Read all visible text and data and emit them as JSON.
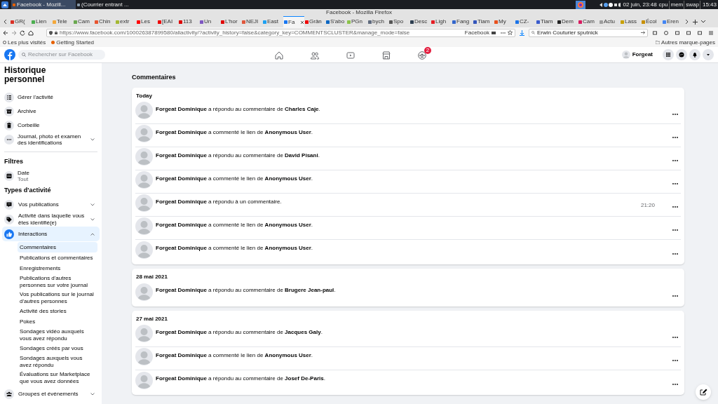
{
  "taskbar": {
    "windows": [
      {
        "title": "Facebook - Mozill...",
        "selected": true
      },
      {
        "title": "(Courrier entrant ...",
        "selected": false
      }
    ],
    "date": "02 juin, 23:48",
    "meters": [
      "cpu",
      "mem",
      "swap"
    ],
    "clock": "15:43"
  },
  "window": {
    "title": "Facebook - Mozilla Firefox"
  },
  "tabs": [
    {
      "label": "GR(",
      "color": "#d93025",
      "selected": false
    },
    {
      "label": "Lien",
      "color": "#4caf50",
      "selected": false
    },
    {
      "label": "Tele",
      "color": "#f4a83a",
      "selected": false
    },
    {
      "label": "Cam",
      "color": "#6aa84f",
      "selected": false
    },
    {
      "label": "Chin",
      "color": "#e8542f",
      "selected": false
    },
    {
      "label": "extr",
      "color": "#a4b832",
      "selected": false
    },
    {
      "label": "Les",
      "color": "#ff0000",
      "selected": false
    },
    {
      "label": "[EAI",
      "color": "#ee0000",
      "selected": false
    },
    {
      "label": "113",
      "color": "#dd0000",
      "selected": false
    },
    {
      "label": "Un",
      "color": "#7e57c2",
      "selected": false
    },
    {
      "label": "L'hor",
      "color": "#e00000",
      "selected": false
    },
    {
      "label": "NEJI",
      "color": "#e0573c",
      "selected": false
    },
    {
      "label": "East",
      "color": "#1da1f2",
      "selected": false
    },
    {
      "label": "Fa",
      "color": "#1877f2",
      "selected": true
    },
    {
      "label": "Grân",
      "color": "#f00000",
      "selected": false
    },
    {
      "label": "S'abo",
      "color": "#0a66c2",
      "selected": false
    },
    {
      "label": "PGn",
      "color": "#8bc34a",
      "selected": false
    },
    {
      "label": "bych",
      "color": "#5f6a7d",
      "selected": false
    },
    {
      "label": "Spo",
      "color": "#555555",
      "selected": false
    },
    {
      "label": "Desc",
      "color": "#2d3e50",
      "selected": false
    },
    {
      "label": "Ligh",
      "color": "#e51c23",
      "selected": false
    },
    {
      "label": "Fang",
      "color": "#3366cc",
      "selected": false
    },
    {
      "label": "Tiam",
      "color": "#3355bb",
      "selected": false
    },
    {
      "label": "My",
      "color": "#e8501d",
      "selected": false
    },
    {
      "label": "CZ-",
      "color": "#1a73e8",
      "selected": false
    },
    {
      "label": "Tiam",
      "color": "#3a5bcc",
      "selected": false
    },
    {
      "label": "Dem",
      "color": "#222222",
      "selected": false
    },
    {
      "label": "Cam",
      "color": "#d81b60",
      "selected": false
    },
    {
      "label": "Actu",
      "color": "#9e9e9e",
      "selected": false
    },
    {
      "label": "Lass",
      "color": "#c8a000",
      "selected": false
    },
    {
      "label": "Écol",
      "color": "#c89000",
      "selected": false
    },
    {
      "label": "Eren",
      "color": "#4285f4",
      "selected": false
    }
  ],
  "address_bar": {
    "url": "https://www.facebook.com/100026387899580/allactivity/?activity_history=false&category_key=COMMENTSCLUSTER&manage_mode=false",
    "site_label": "Facebook"
  },
  "web_search": {
    "value": "Erwin Couturier sputnick"
  },
  "bookmarks": [
    {
      "label": "Les plus visités"
    },
    {
      "label": "Getting Started"
    }
  ],
  "other_bookmarks": "Autres marque-pages",
  "facebook_header": {
    "search_placeholder": "Rechercher sur Facebook",
    "nav": [
      {
        "kind": "home"
      },
      {
        "kind": "friends"
      },
      {
        "kind": "watch"
      },
      {
        "kind": "marketplace"
      },
      {
        "kind": "groups",
        "badge": "2"
      }
    ],
    "profile_name": "Forgeat"
  },
  "sidebar": {
    "title": "Historique personnel",
    "menu": [
      {
        "label": "Gérer l'activité",
        "kind": "list"
      },
      {
        "label": "Archive",
        "kind": "archive"
      },
      {
        "label": "Corbeille",
        "kind": "trash"
      },
      {
        "label": "Journal, photo et examen des identifications",
        "kind": "more",
        "expanded": false
      }
    ],
    "filters_title": "Filtres",
    "filters": [
      {
        "label": "Date",
        "value": "Tout",
        "kind": "calendar"
      }
    ],
    "types_title": "Types d'activité",
    "types": [
      {
        "label": "Vos publications",
        "kind": "post",
        "expanded": false,
        "selected": false
      },
      {
        "label": "Activité dans laquelle vous êtes identifié(e)",
        "kind": "tag",
        "expanded": false,
        "selected": false
      },
      {
        "label": "Interactions",
        "kind": "like",
        "expanded": true,
        "selected": true,
        "children": [
          {
            "label": "Commentaires",
            "selected": true
          },
          {
            "label": "Publications et commentaires",
            "selected": false
          },
          {
            "label": "Enregistrements",
            "selected": false
          },
          {
            "label": "Publications d'autres personnes sur votre journal",
            "selected": false
          },
          {
            "label": "Vos publications sur le journal d'autres personnes",
            "selected": false
          },
          {
            "label": "Activité des stories",
            "selected": false
          },
          {
            "label": "Pokes",
            "selected": false
          },
          {
            "label": "Sondages vidéo auxquels vous avez répondu",
            "selected": false
          },
          {
            "label": "Sondages créés par vous",
            "selected": false
          },
          {
            "label": "Sondages auxquels vous avez répondu",
            "selected": false
          },
          {
            "label": "Évaluations sur Marketplace que vous avez données",
            "selected": false
          }
        ]
      },
      {
        "label": "Groupes et événements",
        "kind": "groups",
        "expanded": false,
        "selected": false
      }
    ]
  },
  "main": {
    "title": "Commentaires",
    "sections": [
      {
        "date": "Today",
        "items": [
          {
            "text": "**Forgeat Dominique** a répondu au commentaire de **Charles Caje**."
          },
          {
            "text": "**Forgeat Dominique** a commenté le lien de **Anonymous User**."
          },
          {
            "text": "**Forgeat Dominique** a répondu au commentaire de **David Pisani**."
          },
          {
            "text": "**Forgeat Dominique** a commenté le lien de **Anonymous User**."
          },
          {
            "text": "**Forgeat Dominique** a répondu à un commentaire.",
            "time": "21:20"
          },
          {
            "text": "**Forgeat Dominique** a commenté le lien de **Anonymous User**."
          },
          {
            "text": "**Forgeat Dominique** a commenté le lien de **Anonymous User**."
          }
        ]
      },
      {
        "date": "28 mai 2021",
        "items": [
          {
            "text": "**Forgeat Dominique** a répondu au commentaire de **Brugere Jean-paul**."
          }
        ]
      },
      {
        "date": "27 mai 2021",
        "items": [
          {
            "text": "**Forgeat Dominique** a répondu au commentaire de **Jacques Galy**."
          },
          {
            "text": "**Forgeat Dominique** a commenté le lien de **Anonymous User**."
          },
          {
            "text": "**Forgeat Dominique** a répondu au commentaire de **Josef De-Paris**."
          }
        ]
      }
    ]
  }
}
